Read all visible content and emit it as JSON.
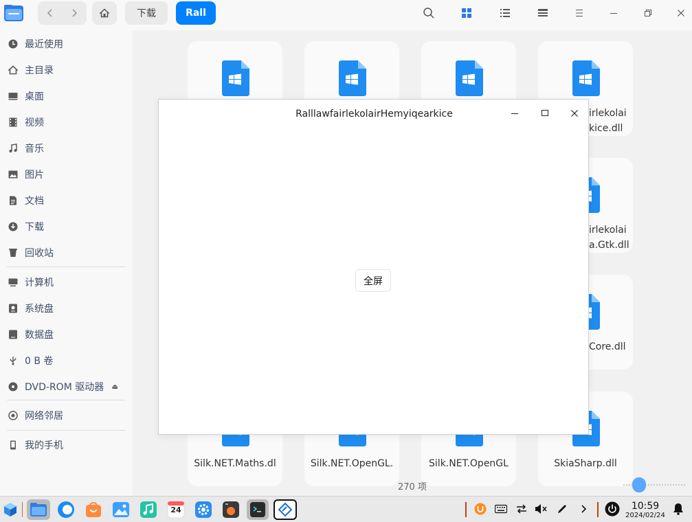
{
  "file_manager": {
    "breadcrumbs": [
      "下载",
      "Rall"
    ],
    "sidebar": {
      "items": [
        {
          "label": "最近使用",
          "icon": "clock-icon"
        },
        {
          "label": "主目录",
          "icon": "home-icon"
        },
        {
          "label": "桌面",
          "icon": "desktop-icon"
        },
        {
          "label": "视频",
          "icon": "video-icon"
        },
        {
          "label": "音乐",
          "icon": "music-icon"
        },
        {
          "label": "图片",
          "icon": "picture-icon"
        },
        {
          "label": "文档",
          "icon": "document-icon"
        },
        {
          "label": "下载",
          "icon": "download-icon"
        },
        {
          "label": "回收站",
          "icon": "trash-icon"
        },
        {
          "label": "计算机",
          "icon": "computer-icon"
        },
        {
          "label": "系统盘",
          "icon": "disk-icon"
        },
        {
          "label": "数据盘",
          "icon": "disk-icon"
        },
        {
          "label": "0 B 卷",
          "icon": "usb-icon"
        },
        {
          "label": "DVD-ROM 驱动器",
          "icon": "dvd-icon"
        },
        {
          "label": "网络邻居",
          "icon": "network-icon"
        },
        {
          "label": "我的手机",
          "icon": "phone-icon"
        }
      ]
    },
    "files_visible_labels": [
      "irlekolai",
      "kice.dll",
      "irlekolai",
      "a.Gtk.dll",
      "Core.dll",
      "Silk.NET.Maths.dl",
      "Silk.NET.OpenGL.",
      "Silk.NET.OpenGL",
      "SkiaSharp.dll"
    ],
    "status_count": "270 项",
    "accent_color": "#0081ff"
  },
  "dialog": {
    "title": "RalllawfairlekolairHemyiqearkice",
    "fullscreen_button": "全屏"
  },
  "taskbar": {
    "clock_time": "10:59",
    "clock_date": "2024/02/24",
    "calendar_day": "24"
  }
}
